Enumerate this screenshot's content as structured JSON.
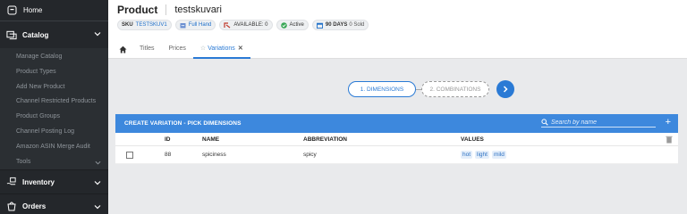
{
  "sidebar": {
    "home": "Home",
    "catalog": "Catalog",
    "catalog_items": [
      "Manage Catalog",
      "Product Types",
      "Add New Product",
      "Channel Restricted Products",
      "Product Groups",
      "Channel Posting Log",
      "Amazon ASIN Merge Audit",
      "Tools"
    ],
    "inventory": "Inventory",
    "orders": "Orders"
  },
  "header": {
    "title": "Product",
    "product_name": "testskuvari",
    "badges": {
      "sku_key": "SKU",
      "sku_value": "TESTSKUV1",
      "fulfillment": "Full Hand",
      "available": "AVAILABLE: 0",
      "status": "Active",
      "days_key": "90 DAYS",
      "days_value": "0 Sold"
    }
  },
  "tabs": {
    "titles": "Titles",
    "prices": "Prices",
    "variations": "Variations"
  },
  "steps": {
    "step1": "1. DIMENSIONS",
    "step2": "2. COMBINATIONS"
  },
  "panel": {
    "title": "CREATE VARIATION - PICK DIMENSIONS",
    "search_placeholder": "Search by name",
    "columns": {
      "id": "ID",
      "name": "NAME",
      "abbreviation": "ABBREVIATION",
      "values": "VALUES"
    },
    "rows": [
      {
        "id": "88",
        "name": "spiciness",
        "abbreviation": "spicy",
        "values": [
          "hot",
          "light",
          "mild"
        ]
      }
    ]
  },
  "colors": {
    "accent": "#2a7ad5",
    "panel_header": "#3d88dd",
    "sidebar_bg": "#2b2f33"
  }
}
